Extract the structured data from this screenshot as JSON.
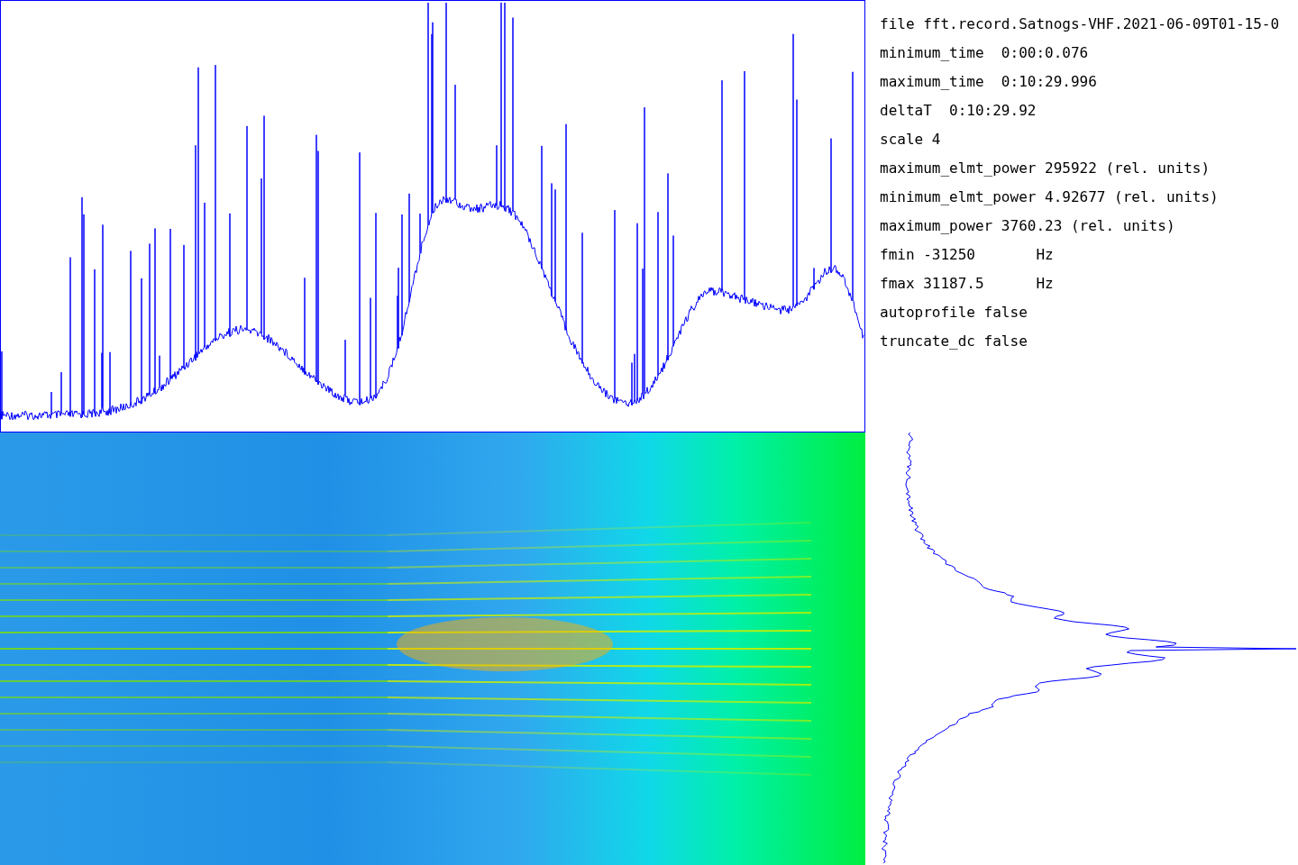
{
  "info_panel": {
    "lines": [
      "file fft.record.Satnogs-VHF.2021-06-09T01-15-0",
      "minimum_time  0:00:0.076",
      "maximum_time  0:10:29.996",
      "deltaT  0:10:29.92",
      "scale 4",
      "maximum_elmt_power 295922 (rel. units)",
      "minimum_elmt_power 4.92677 (rel. units)",
      "maximum_power 3760.23 (rel. units)",
      "fmin -31250       Hz",
      "fmax 31187.5      Hz",
      "autoprofile false",
      "truncate_dc false"
    ]
  }
}
